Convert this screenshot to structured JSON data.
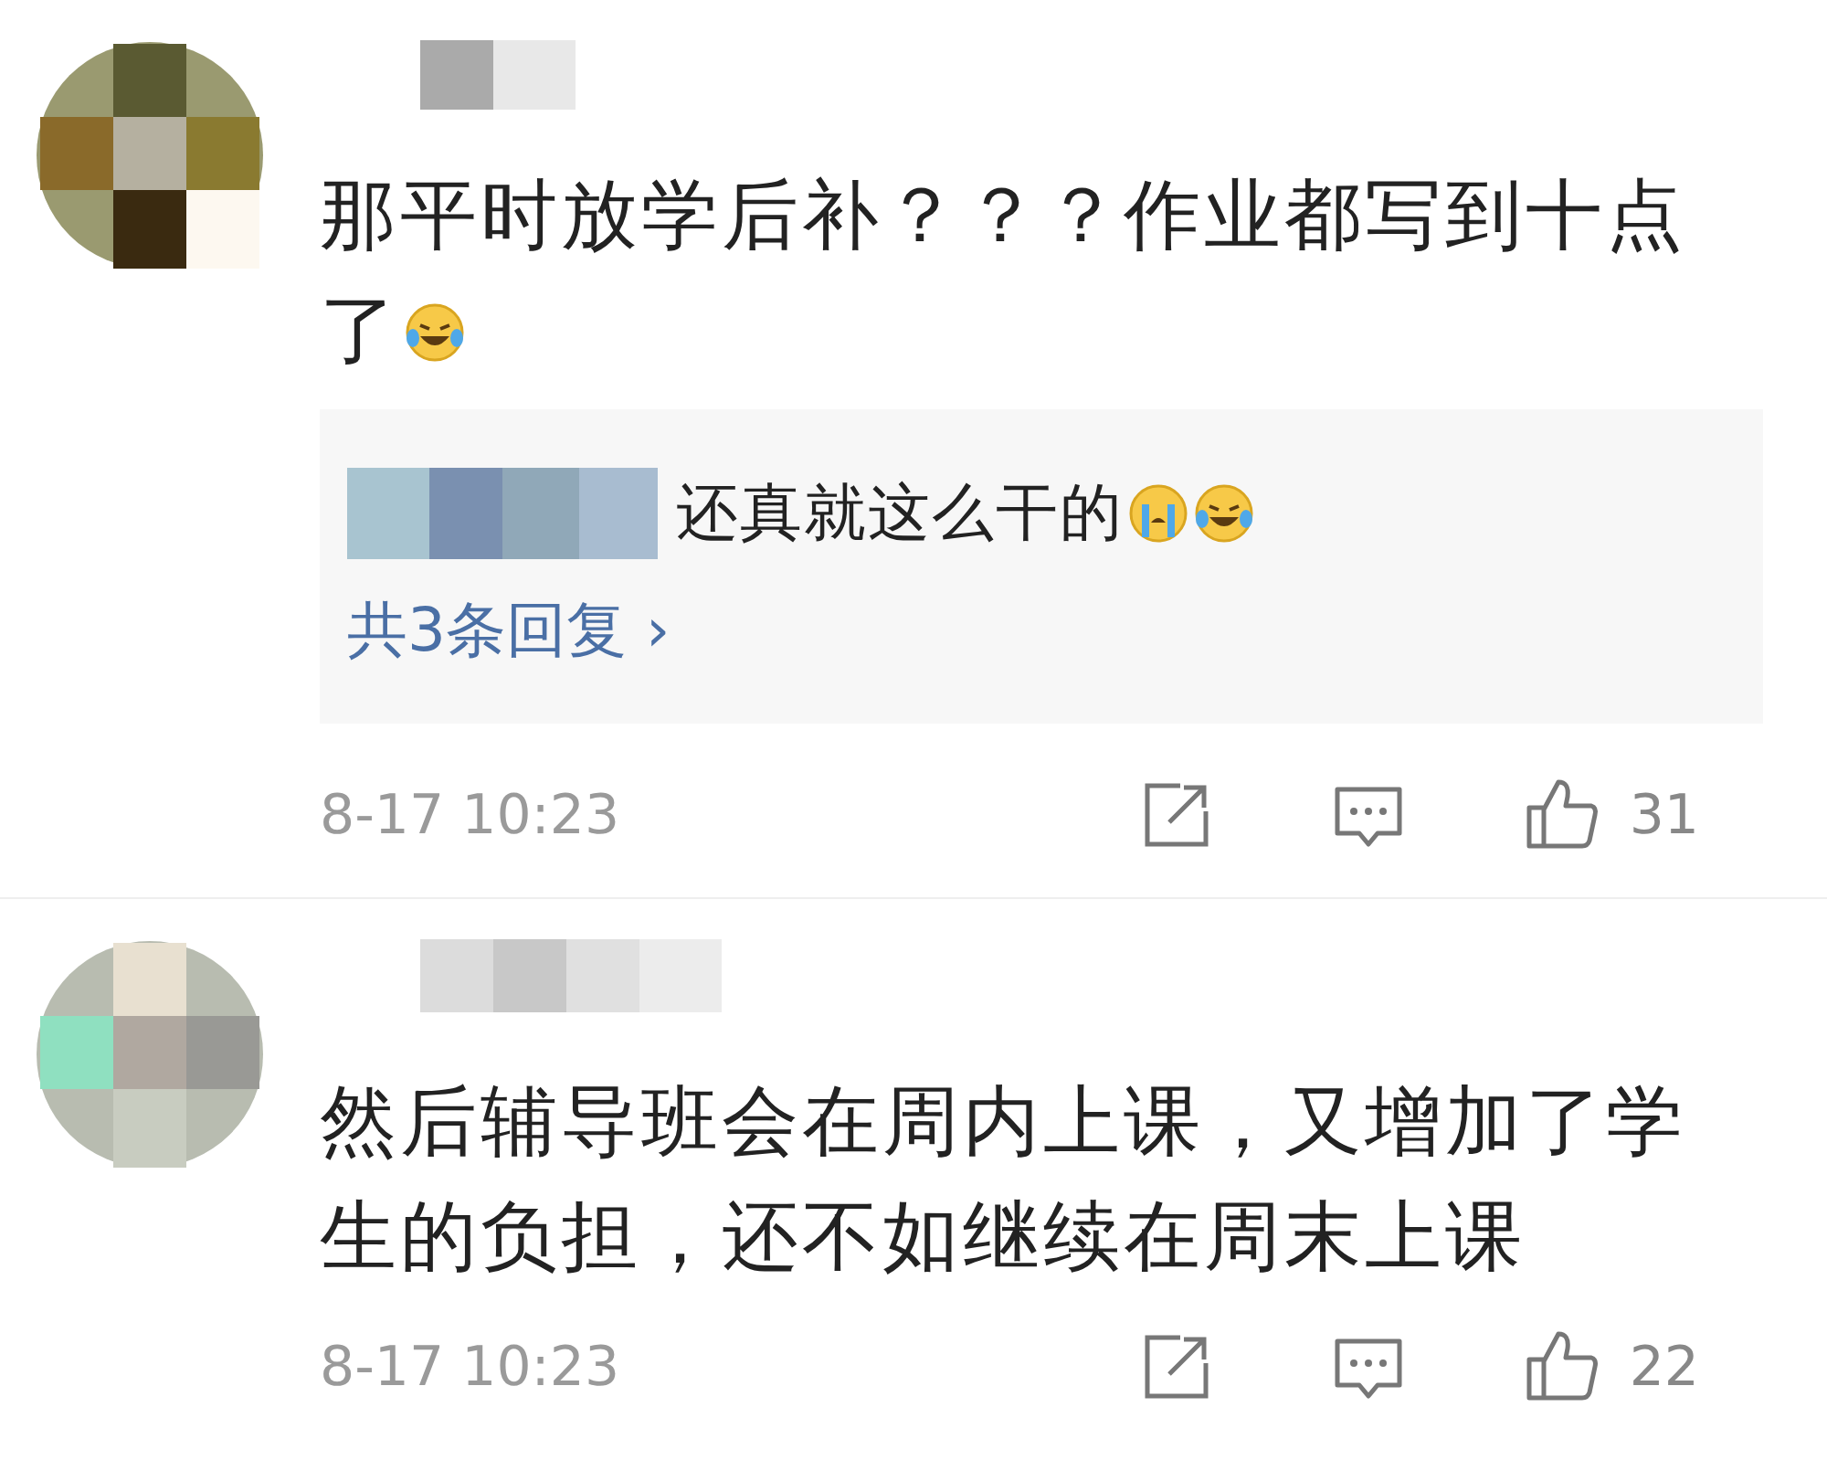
{
  "comments": [
    {
      "text": "那平时放学后补？？？作业都写到十点了",
      "emojis": [
        {
          "kind": "tears-of-joy"
        }
      ],
      "reply_preview": {
        "text": "还真就这么干的",
        "emojis": [
          {
            "kind": "crying"
          },
          {
            "kind": "tears-of-joy"
          }
        ],
        "more": "共3条回复",
        "more_arrow": "›"
      },
      "time": "8-17 10:23",
      "likes": "31"
    },
    {
      "text": "然后辅导班会在周内上课，又增加了学生的负担，还不如继续在周末上课",
      "time": "8-17 10:23",
      "likes": "22"
    }
  ]
}
